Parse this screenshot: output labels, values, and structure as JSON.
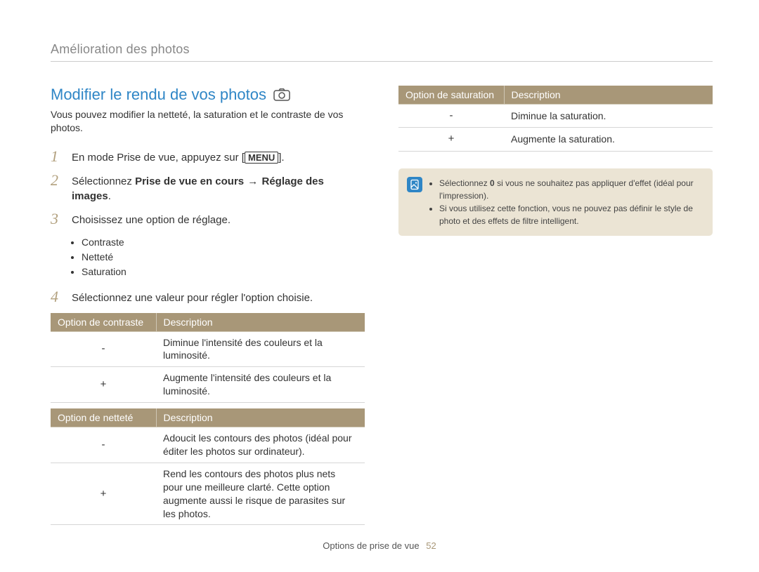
{
  "breadcrumb": "Amélioration des photos",
  "section_title": "Modifier le rendu de vos photos",
  "intro": "Vous pouvez modifier la netteté, la saturation et le contraste de vos photos.",
  "steps": {
    "s1_pre": "En mode Prise de vue, appuyez sur [",
    "s1_menu": "MENU",
    "s1_post": "].",
    "s2_pre": "Sélectionnez ",
    "s2_b1": "Prise de vue en cours",
    "s2_arrow": " → ",
    "s2_b2": "Réglage des images",
    "s2_post": ".",
    "s3": "Choisissez une option de réglage.",
    "s4": "Sélectionnez une valeur pour régler l'option choisie."
  },
  "bullets": [
    "Contraste",
    "Netteté",
    "Saturation"
  ],
  "table_contrast": {
    "h1": "Option de contraste",
    "h2": "Description",
    "rows": [
      {
        "sym": "-",
        "desc": "Diminue l'intensité des couleurs et la luminosité."
      },
      {
        "sym": "+",
        "desc": "Augmente l'intensité des couleurs et la luminosité."
      }
    ]
  },
  "table_sharpness": {
    "h1": "Option de netteté",
    "h2": "Description",
    "rows": [
      {
        "sym": "-",
        "desc": "Adoucit les contours des photos (idéal pour éditer les photos sur ordinateur)."
      },
      {
        "sym": "+",
        "desc": "Rend les contours des photos plus nets pour une meilleure clarté. Cette option augmente aussi le risque de parasites sur les photos."
      }
    ]
  },
  "table_saturation": {
    "h1": "Option de saturation",
    "h2": "Description",
    "rows": [
      {
        "sym": "-",
        "desc": "Diminue la saturation."
      },
      {
        "sym": "+",
        "desc": "Augmente la saturation."
      }
    ]
  },
  "notes": {
    "n1_pre": "Sélectionnez ",
    "n1_bold": "0",
    "n1_post": " si vous ne souhaitez pas appliquer d'effet (idéal pour l'impression).",
    "n2": "Si vous utilisez cette fonction, vous ne pouvez pas définir le style de photo et des effets de filtre intelligent."
  },
  "footer": {
    "label": "Options de prise de vue",
    "page": "52"
  }
}
